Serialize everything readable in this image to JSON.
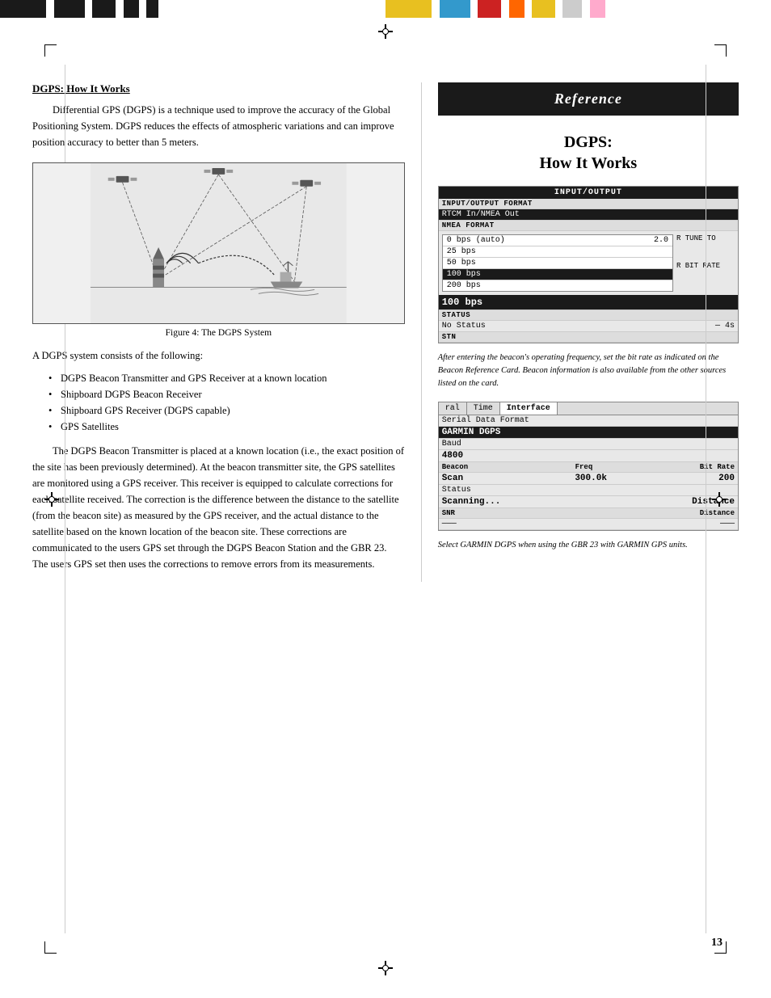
{
  "page": {
    "number": "13"
  },
  "top_bar": {
    "left_segments": [
      {
        "color": "#1a1a1a",
        "width": "12%"
      },
      {
        "color": "#fff",
        "width": "2%"
      },
      {
        "color": "#1a1a1a",
        "width": "8%"
      },
      {
        "color": "#fff",
        "width": "2%"
      },
      {
        "color": "#1a1a1a",
        "width": "6%"
      },
      {
        "color": "#fff",
        "width": "2%"
      },
      {
        "color": "#1a1a1a",
        "width": "4%"
      },
      {
        "color": "#fff",
        "width": "2%"
      },
      {
        "color": "#1a1a1a",
        "width": "3%"
      },
      {
        "color": "#fff",
        "width": "59%"
      }
    ],
    "right_segments": [
      {
        "color": "#e8c020",
        "width": "12%"
      },
      {
        "color": "#fff",
        "width": "2%"
      },
      {
        "color": "#3399cc",
        "width": "8%"
      },
      {
        "color": "#fff",
        "width": "2%"
      },
      {
        "color": "#cc2222",
        "width": "6%"
      },
      {
        "color": "#fff",
        "width": "2%"
      },
      {
        "color": "#ff6600",
        "width": "4%"
      },
      {
        "color": "#fff",
        "width": "2%"
      },
      {
        "color": "#e8c020",
        "width": "6%"
      },
      {
        "color": "#fff",
        "width": "2%"
      },
      {
        "color": "#cccccc",
        "width": "5%"
      },
      {
        "color": "#fff",
        "width": "2%"
      },
      {
        "color": "#ffaacc",
        "width": "4%"
      },
      {
        "color": "#fff",
        "width": "43%"
      }
    ]
  },
  "reference_tab": {
    "label": "Reference"
  },
  "right_section_title": {
    "line1": "DGPS:",
    "line2": "How It Works"
  },
  "left_section": {
    "heading": "DGPS: How It Works",
    "paragraph1": "Differential GPS (DGPS) is a technique used to improve the accuracy of the Global Positioning System. DGPS reduces the effects of atmospheric variations and can improve position accuracy to better than 5 meters.",
    "figure_caption": "Figure 4: The DGPS System",
    "intro_list": "A DGPS system consists of the following:",
    "bullets": [
      "DGPS Beacon Transmitter and GPS Receiver at a known location",
      "Shipboard DGPS Beacon Receiver",
      "Shipboard GPS Receiver (DGPS capable)",
      "GPS Satellites"
    ],
    "paragraph2": "The DGPS Beacon Transmitter is placed at a known location (i.e., the exact position of the site has been previously determined).  At the beacon transmitter site, the GPS satellites are monitored using a GPS receiver. This receiver is equipped to calculate corrections for each satellite received. The correction is the difference between the distance to the satellite (from the beacon site) as measured by the GPS receiver, and the actual distance to the satellite based on the known location of the beacon site. These corrections are communicated to the users GPS set through the DGPS Beacon Station and the GBR 23. The users GPS set then uses the corrections to remove errors from its measurements."
  },
  "device1": {
    "header": "INPUT/OUTPUT",
    "subheader": "INPUT/OUTPUT FORMAT",
    "row1": "RTCM In/NMEA Out",
    "nmea_label": "NMEA  FORMAT",
    "dropdown": {
      "items": [
        {
          "label": "0 bps (auto)",
          "suffix": "2.0",
          "selected": false
        },
        {
          "label": "25 bps",
          "selected": false
        },
        {
          "label": "50 bps",
          "selected": false
        },
        {
          "label": "100 bps",
          "selected": true
        },
        {
          "label": "200 bps",
          "selected": false
        }
      ]
    },
    "r_tune_label": "R  TUNE  TO",
    "r_bit_rate_label": "R  BIT  RATE",
    "selected_value": "100 bps",
    "status_label": "STATUS",
    "status_value": "No Status",
    "status_suffix": "—  4s",
    "bottom_label": "STN"
  },
  "device1_caption": "After entering the beacon's operating frequency, set the bit rate as indicated on the Beacon Reference Card. Beacon information is also available from the other sources listed on the card.",
  "device2": {
    "tabs": [
      "ral",
      "Time",
      "Interface"
    ],
    "active_tab": "Interface",
    "serial_label": "Serial Data Format",
    "selected_format": "GARMIN DGPS",
    "baud_label": "Baud",
    "baud_value": "4800",
    "col_headers": [
      "Beacon",
      "Freq",
      "Bit Rate"
    ],
    "scan_row": [
      "Scan",
      "300.0k",
      "200"
    ],
    "status_label": "Status",
    "status_value": "Scanning...",
    "snr_distance_header": [
      "SNR",
      "Distance"
    ],
    "snr_row": [
      "———",
      "———"
    ]
  },
  "device2_caption": "Select GARMIN DGPS when using the GBR 23 with GARMIN GPS units."
}
